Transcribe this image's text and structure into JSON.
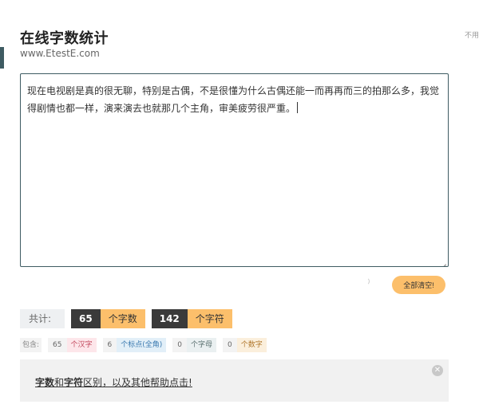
{
  "header": {
    "title": "在线字数统计",
    "url": "www.EtestE.com",
    "right_note": "不用"
  },
  "editor": {
    "text": "现在电视剧是真的很无聊，特别是古偶，不是很懂为什么古偶还能一而再再而三的拍那么多，我觉得剧情也都一样，演来演去也就那几个主角，审美疲劳很严重。"
  },
  "actions": {
    "clear_label": "全部清空!"
  },
  "summary": {
    "total_label": "共计:",
    "word_count": "65",
    "word_unit": "个字数",
    "char_count": "142",
    "char_unit": "个字符"
  },
  "breakdown": {
    "label": "包含:",
    "hanzi_count": "65",
    "hanzi_label": "个汉字",
    "punct_count": "6",
    "punct_label": "个标点(全角)",
    "letter_count": "0",
    "letter_label": "个字母",
    "digit_count": "0",
    "digit_label": "个数字"
  },
  "help": {
    "part1": "字数",
    "part2": "和",
    "part3": "字符",
    "part4": "区别，以及其他帮助点击!",
    "close_glyph": "✕"
  }
}
